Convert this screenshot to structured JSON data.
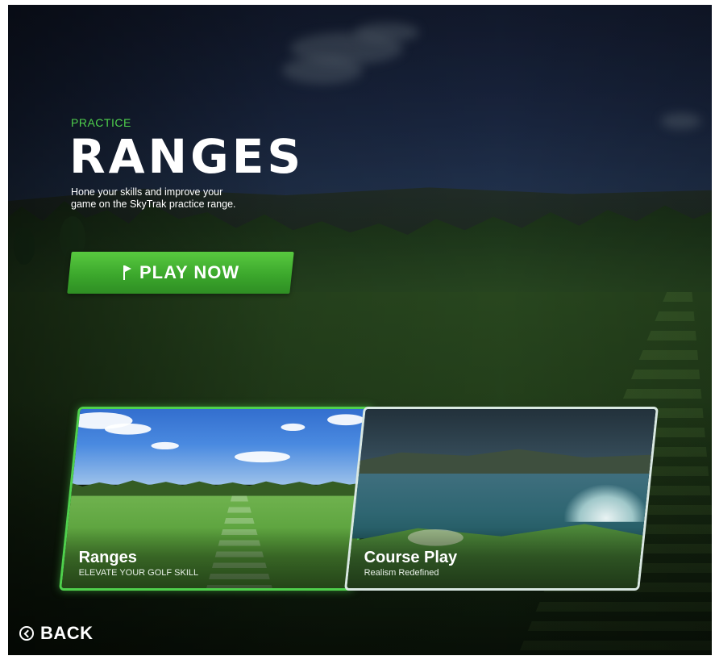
{
  "hero": {
    "eyebrow": "PRACTICE",
    "title": "RANGES",
    "description": "Hone your skills and improve your game on the SkyTrak practice range.",
    "play_label": "PLAY NOW",
    "play_icon": "flag-icon"
  },
  "cards": [
    {
      "title": "Ranges",
      "subtitle": "ELEVATE YOUR GOLF SKILL",
      "selected": true
    },
    {
      "title": "Course Play",
      "subtitle": "Realism Redefined",
      "selected": false
    }
  ],
  "nav": {
    "back_label": "BACK",
    "back_icon": "chevron-left-circle-icon"
  },
  "colors": {
    "accent": "#4fd04c",
    "button": "#3aa52b"
  }
}
